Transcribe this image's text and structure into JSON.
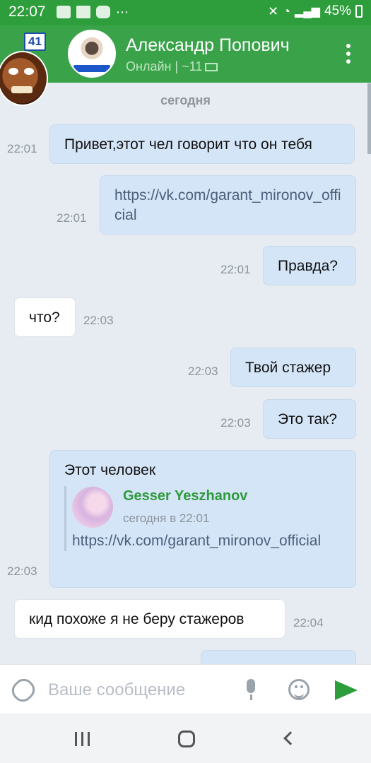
{
  "status_bar": {
    "time": "22:07",
    "battery": "45%"
  },
  "header": {
    "contact_name": "Александр Попович",
    "status": "Онлайн | ~11",
    "badge_count": "41"
  },
  "chat": {
    "date_separator": "сегодня",
    "messages": [
      {
        "direction": "out",
        "text": "Привет,этот чел говорит что он тебя",
        "time": "22:01"
      },
      {
        "direction": "out",
        "text": "https://vk.com/garant_mironov_official",
        "time": "22:01"
      },
      {
        "direction": "out",
        "text": "Правда?",
        "time": "22:01"
      },
      {
        "direction": "in",
        "text": "что?",
        "time": "22:03"
      },
      {
        "direction": "out",
        "text": "Твой стажер",
        "time": "22:03"
      },
      {
        "direction": "out",
        "text": "Это так?",
        "time": "22:03"
      },
      {
        "direction": "out",
        "text": "Этот человек",
        "time": "22:03",
        "forwarded": {
          "author": "Gesser Yeszhanov",
          "date": "сегодня в 22:01",
          "text": "https://vk.com/garant_mironov_official"
        }
      },
      {
        "direction": "in",
        "text": "кид похоже я не беру стажеров",
        "time": "22:04"
      }
    ]
  },
  "input": {
    "placeholder": "Ваше сообщение"
  },
  "colors": {
    "accent": "#3aa34a",
    "outgoing_bubble": "#d4e5f7",
    "incoming_bubble": "#ffffff"
  },
  "icons": [
    "attach-icon",
    "mic-icon",
    "emoji-icon",
    "send-icon",
    "menu-icon"
  ]
}
